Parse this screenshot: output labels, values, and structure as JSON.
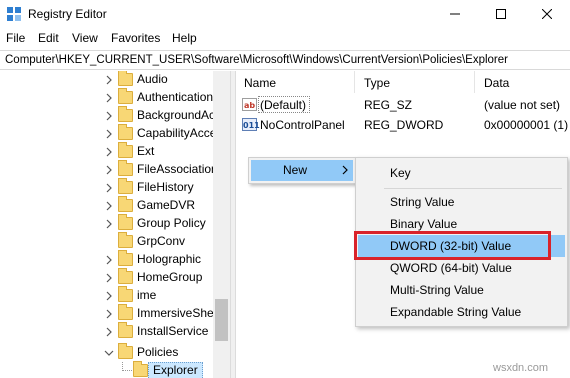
{
  "window": {
    "title": "Registry Editor",
    "icon": "registry-icon",
    "controls": [
      "minimize-icon",
      "maximize-icon",
      "close-icon"
    ]
  },
  "menu": [
    "File",
    "Edit",
    "View",
    "Favorites",
    "Help"
  ],
  "address": "Computer\\HKEY_CURRENT_USER\\Software\\Microsoft\\Windows\\CurrentVersion\\Policies\\Explorer",
  "tree": {
    "items": [
      {
        "label": "Audio"
      },
      {
        "label": "Authentication"
      },
      {
        "label": "BackgroundAc"
      },
      {
        "label": "CapabilityAcce"
      },
      {
        "label": "Ext"
      },
      {
        "label": "FileAssociation"
      },
      {
        "label": "FileHistory"
      },
      {
        "label": "GameDVR"
      },
      {
        "label": "Group Policy"
      },
      {
        "label": "GrpConv"
      },
      {
        "label": "Holographic"
      },
      {
        "label": "HomeGroup"
      },
      {
        "label": "ime"
      },
      {
        "label": "ImmersiveShel"
      },
      {
        "label": "InstallService"
      },
      {
        "label": "Policies",
        "expanded": true
      },
      {
        "label": "Explorer",
        "selected": true
      }
    ]
  },
  "list": {
    "columns": [
      "Name",
      "Type",
      "Data"
    ],
    "rows": [
      {
        "name": "(Default)",
        "type": "REG_SZ",
        "data": "(value not set)",
        "icon": "string-value-icon"
      },
      {
        "name": "NoControlPanel",
        "type": "REG_DWORD",
        "data": "0x00000001 (1)",
        "icon": "dword-value-icon"
      }
    ]
  },
  "context_menu": {
    "new_label": "New",
    "submenu": [
      "Key",
      "String Value",
      "Binary Value",
      "DWORD (32-bit) Value",
      "QWORD (64-bit) Value",
      "Multi-String Value",
      "Expandable String Value"
    ],
    "highlighted": "DWORD (32-bit) Value",
    "highlight_color": "#d9232a",
    "hover_color": "#91c9f7"
  },
  "watermark": "wsxdn.com"
}
